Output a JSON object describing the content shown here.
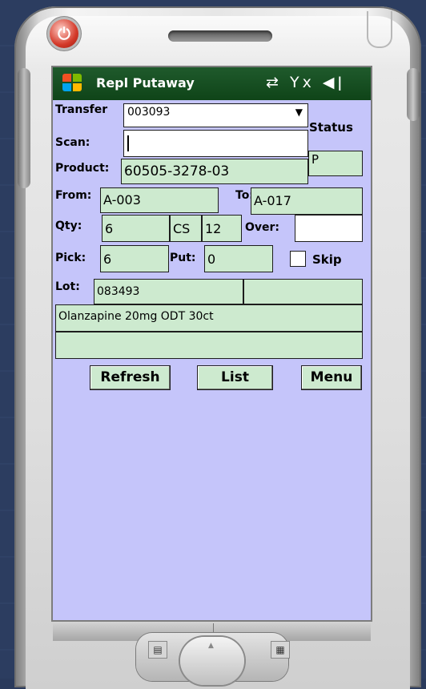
{
  "device": {
    "power_symbol": "⏻",
    "hw_left_symbol": "▤",
    "hw_right_symbol": "▦",
    "dpad_symbol": "▲"
  },
  "titlebar": {
    "title": "Repl Putaway",
    "status_icons": "⇄ Yx ◀︎ǀ"
  },
  "form": {
    "transfer_label": "Transfer",
    "transfer_value": "003093",
    "status_label": "Status",
    "status_value": "P",
    "scan_label": "Scan:",
    "scan_value": "",
    "product_label": "Product:",
    "product_value": "60505-3278-03",
    "from_label": "From:",
    "from_value": "A-003",
    "to_label": "To:",
    "to_value": "A-017",
    "qty_label": "Qty:",
    "qty_value": "6",
    "uom_value": "CS",
    "pack_value": "12",
    "over_label": "Over:",
    "over_value": "",
    "pick_label": "Pick:",
    "pick_value": "6",
    "put_label": "Put:",
    "put_value": "0",
    "skip_label": "Skip",
    "lot_label": "Lot:",
    "lot_value": "083493",
    "lot_extra": "",
    "description": "Olanzapine 20mg ODT 30ct",
    "description2": ""
  },
  "buttons": {
    "refresh": "Refresh",
    "list": "List",
    "menu": "Menu"
  },
  "colors": {
    "screen_bg": "#c5c5fa",
    "field_bg": "#cdeacf",
    "titlebar_bg": "#0f4418"
  }
}
